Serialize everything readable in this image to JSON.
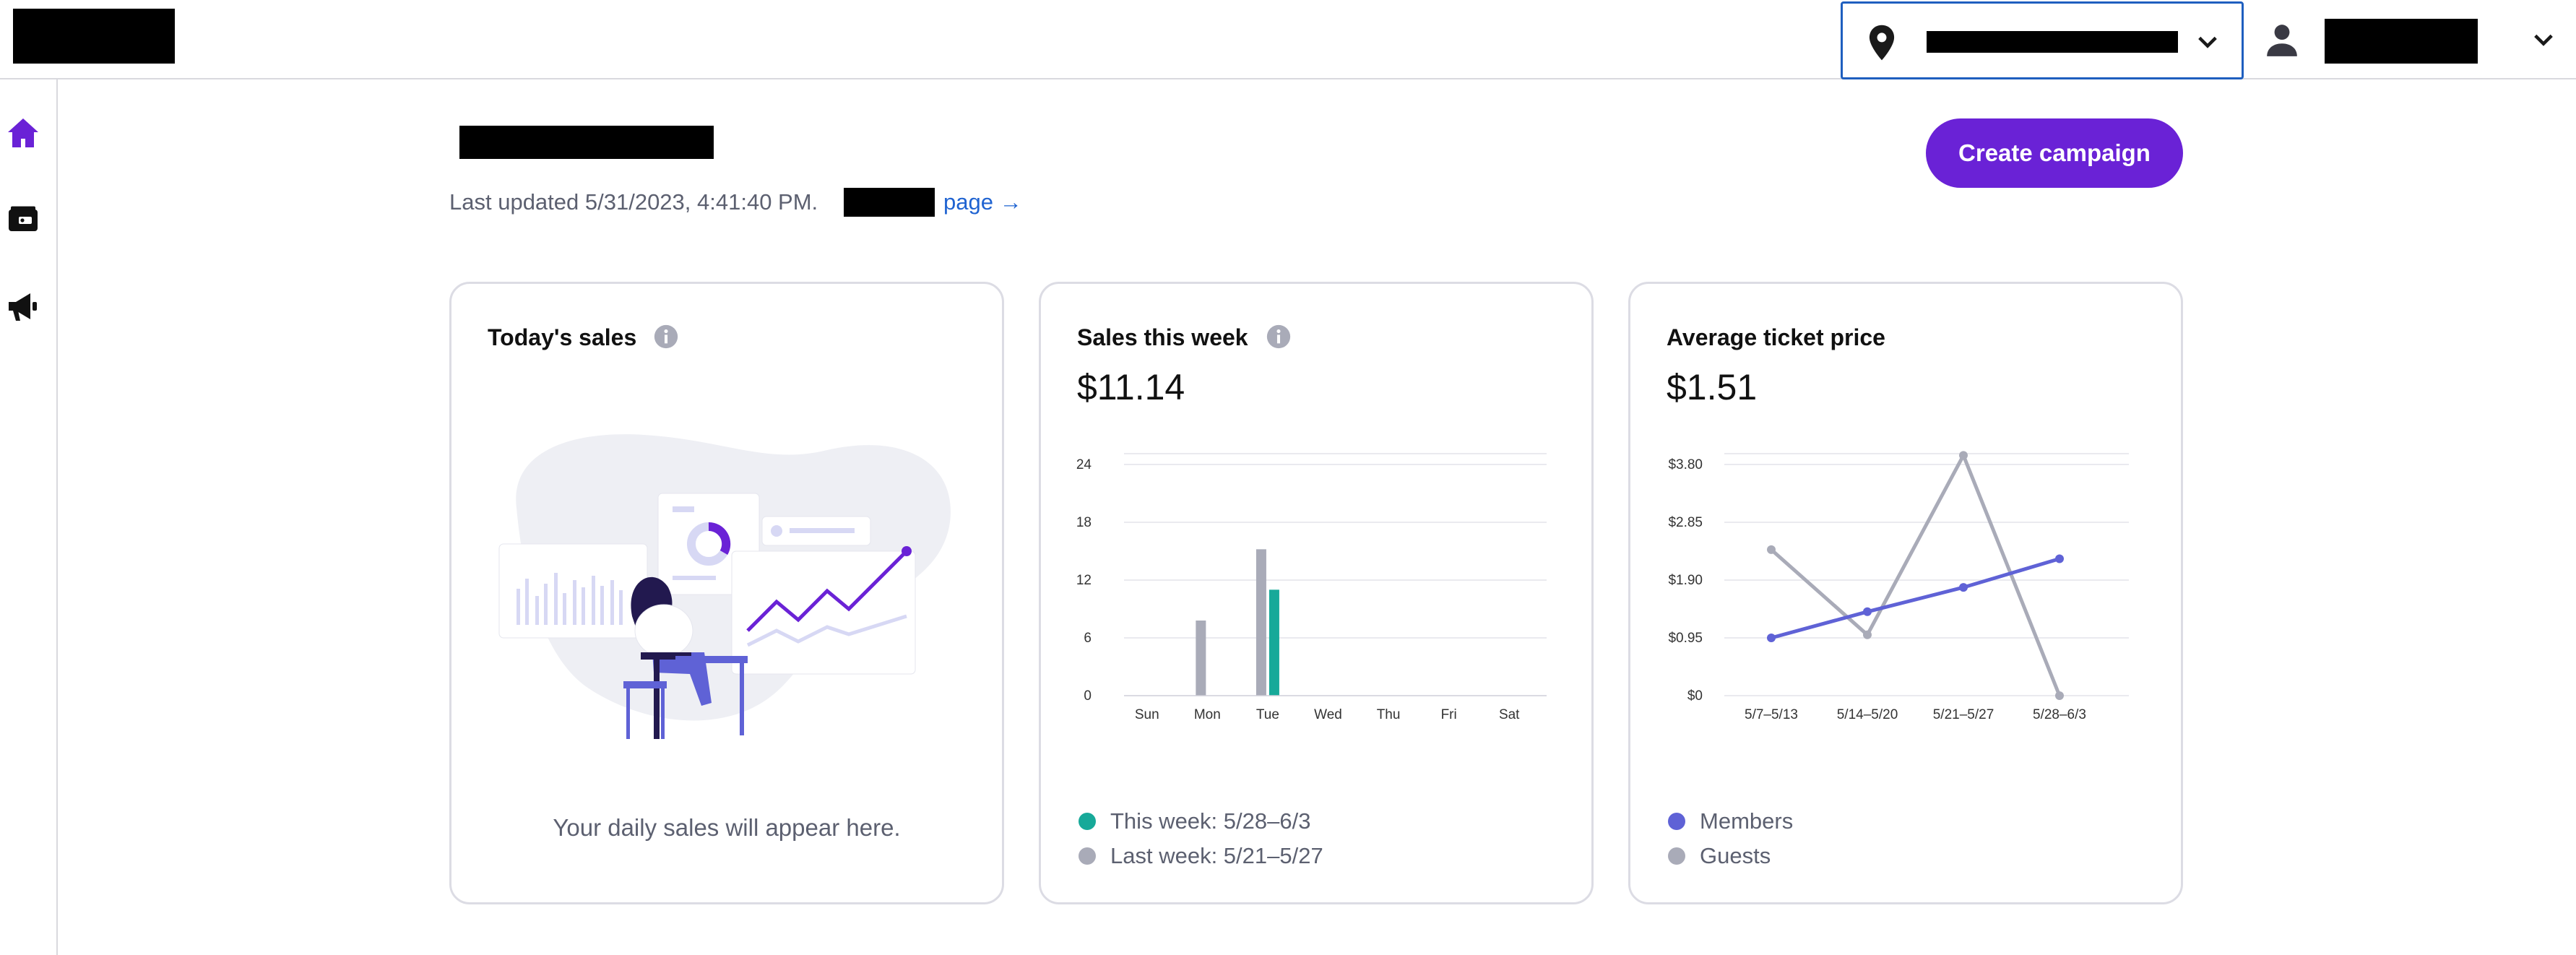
{
  "header": {
    "location_icon": "map-pin-icon",
    "location_chevron_icon": "chevron-down-icon",
    "user_icon": "person-icon",
    "user_chevron_icon": "chevron-down-icon"
  },
  "sidebar": {
    "items": [
      {
        "icon": "home-icon",
        "active": true
      },
      {
        "icon": "wallet-icon",
        "active": false
      },
      {
        "icon": "megaphone-icon",
        "active": false
      }
    ],
    "active_color": "#6a22d6"
  },
  "page": {
    "last_updated": "Last updated 5/31/2023, 4:41:40 PM.",
    "page_link": "page →",
    "create_button": "Create campaign"
  },
  "cards": {
    "today": {
      "title": "Today's sales",
      "empty_message": "Your daily sales will appear here."
    },
    "week": {
      "title": "Sales this week",
      "value": "$11.14"
    },
    "avg": {
      "title": "Average ticket price",
      "value": "$1.51"
    }
  },
  "colors": {
    "accent": "#6a22d6",
    "link": "#1f63d1",
    "this_week": "#17a999",
    "last_week": "#a9abb8",
    "members": "#5f62d6",
    "guests": "#a9abb8"
  },
  "chart_data": [
    {
      "type": "bar",
      "categories": [
        "Sun",
        "Mon",
        "Tue",
        "Wed",
        "Thu",
        "Fri",
        "Sat"
      ],
      "ylim": [
        0,
        24
      ],
      "yticks": [
        0,
        6,
        12,
        18,
        24
      ],
      "grid": true,
      "legend_placement": "bottom-left",
      "series": [
        {
          "name": "This week: 5/28–6/3",
          "color": "#17a999",
          "values": [
            0,
            0,
            11,
            0,
            0,
            0,
            0
          ]
        },
        {
          "name": "Last week: 5/21–5/27",
          "color": "#a9abb8",
          "values": [
            0,
            7.8,
            15.2,
            0,
            0,
            0,
            0
          ]
        }
      ]
    },
    {
      "type": "line",
      "categories": [
        "5/7–5/13",
        "5/14–5/20",
        "5/21–5/27",
        "5/28–6/3"
      ],
      "ylim": [
        0,
        3.8
      ],
      "yticks": [
        "$0",
        "$0.95",
        "$1.90",
        "$2.85",
        "$3.80"
      ],
      "ytick_values": [
        0,
        0.95,
        1.9,
        2.85,
        3.8
      ],
      "grid": true,
      "legend_placement": "bottom-left",
      "series": [
        {
          "name": "Members",
          "color": "#5f62d6",
          "values": [
            0.95,
            1.38,
            1.78,
            2.25
          ]
        },
        {
          "name": "Guests",
          "color": "#a9abb8",
          "values": [
            2.4,
            1.0,
            3.95,
            0.0
          ]
        }
      ]
    }
  ]
}
